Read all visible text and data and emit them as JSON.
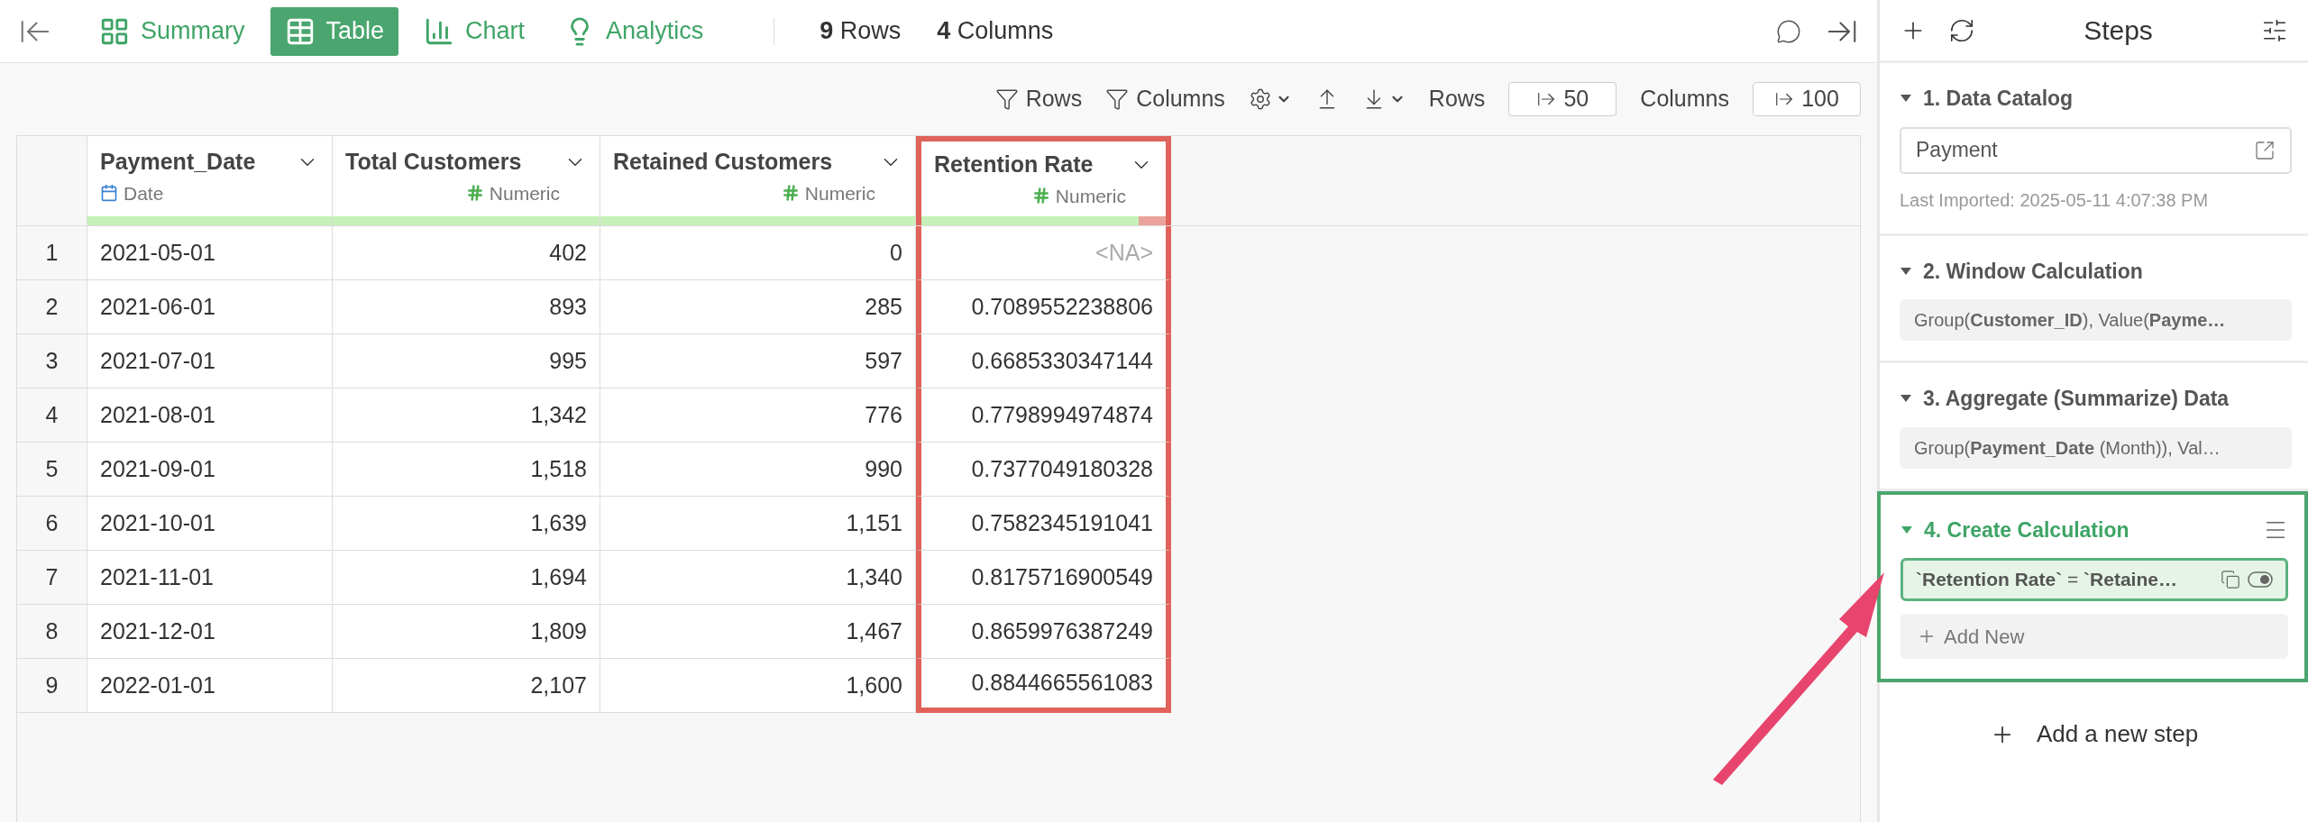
{
  "top_bar": {
    "tabs": [
      {
        "label": "Summary",
        "kind": "summary",
        "selected": false
      },
      {
        "label": "Table",
        "kind": "table",
        "selected": true
      },
      {
        "label": "Chart",
        "kind": "chart",
        "selected": false
      },
      {
        "label": "Analytics",
        "kind": "analytics",
        "selected": false
      }
    ],
    "counts": [
      "**9** Rows",
      "**4** Columns"
    ]
  },
  "toolbar": {
    "filters": [
      "Rows",
      "Columns"
    ],
    "rows_label": "Rows",
    "rows_value": "50",
    "columns_label": "Columns",
    "columns_value": "100"
  },
  "table": {
    "columns": [
      {
        "name": "Payment_Date",
        "type": "Date",
        "kind": "date",
        "level": 1,
        "highlighted": false
      },
      {
        "name": "Total Customers",
        "type": "Numeric",
        "kind": "numeric",
        "level": 1,
        "highlighted": false
      },
      {
        "name": "Retained Customers",
        "type": "Numeric",
        "kind": "numeric",
        "level": 1,
        "highlighted": false
      },
      {
        "name": "Retention Rate",
        "type": "Numeric",
        "kind": "numeric",
        "level": 0.89,
        "highlighted": true
      }
    ],
    "rows": [
      {
        "index": "1",
        "cells": [
          {
            "text": "2021-05-01",
            "missing": false
          },
          {
            "text": "402",
            "missing": false
          },
          {
            "text": "0",
            "missing": false
          },
          {
            "text": "<NA>",
            "missing": true
          }
        ]
      },
      {
        "index": "2",
        "cells": [
          {
            "text": "2021-06-01",
            "missing": false
          },
          {
            "text": "893",
            "missing": false
          },
          {
            "text": "285",
            "missing": false
          },
          {
            "text": "0.7089552238806",
            "missing": false
          }
        ]
      },
      {
        "index": "3",
        "cells": [
          {
            "text": "2021-07-01",
            "missing": false
          },
          {
            "text": "995",
            "missing": false
          },
          {
            "text": "597",
            "missing": false
          },
          {
            "text": "0.6685330347144",
            "missing": false
          }
        ]
      },
      {
        "index": "4",
        "cells": [
          {
            "text": "2021-08-01",
            "missing": false
          },
          {
            "text": "1,342",
            "missing": false
          },
          {
            "text": "776",
            "missing": false
          },
          {
            "text": "0.7798994974874",
            "missing": false
          }
        ]
      },
      {
        "index": "5",
        "cells": [
          {
            "text": "2021-09-01",
            "missing": false
          },
          {
            "text": "1,518",
            "missing": false
          },
          {
            "text": "990",
            "missing": false
          },
          {
            "text": "0.7377049180328",
            "missing": false
          }
        ]
      },
      {
        "index": "6",
        "cells": [
          {
            "text": "2021-10-01",
            "missing": false
          },
          {
            "text": "1,639",
            "missing": false
          },
          {
            "text": "1,151",
            "missing": false
          },
          {
            "text": "0.7582345191041",
            "missing": false
          }
        ]
      },
      {
        "index": "7",
        "cells": [
          {
            "text": "2021-11-01",
            "missing": false
          },
          {
            "text": "1,694",
            "missing": false
          },
          {
            "text": "1,340",
            "missing": false
          },
          {
            "text": "0.8175716900549",
            "missing": false
          }
        ]
      },
      {
        "index": "8",
        "cells": [
          {
            "text": "2021-12-01",
            "missing": false
          },
          {
            "text": "1,809",
            "missing": false
          },
          {
            "text": "1,467",
            "missing": false
          },
          {
            "text": "0.8659976387249",
            "missing": false
          }
        ]
      },
      {
        "index": "9",
        "cells": [
          {
            "text": "2022-01-01",
            "missing": false
          },
          {
            "text": "2,107",
            "missing": false
          },
          {
            "text": "1,600",
            "missing": false
          },
          {
            "text": "0.8844665561083",
            "missing": false
          }
        ]
      }
    ]
  },
  "sidebar": {
    "title": "Steps",
    "steps": [
      {
        "title": "1. Data Catalog",
        "kind": "catalog",
        "selected": false,
        "expanded": true,
        "value": "Payment",
        "note": "Last Imported: 2025-05-11 4:07:38 PM"
      },
      {
        "title": "2. Window Calculation",
        "kind": "summary",
        "selected": false,
        "expanded": true,
        "summary": "Group(**Customer_ID**), Value(**Payme…**"
      },
      {
        "title": "3. Aggregate (Summarize) Data",
        "kind": "summary",
        "selected": false,
        "expanded": true,
        "summary": "Group(**Payment_Date** (Month)), Val…"
      },
      {
        "title": "4. Create Calculation",
        "kind": "calculation",
        "selected": true,
        "expanded": true,
        "formula": "**`Retention Rate`** = **`Retaine…**",
        "formula_on": true,
        "add_label": "Add New"
      }
    ],
    "add_step": "Add a new step"
  }
}
